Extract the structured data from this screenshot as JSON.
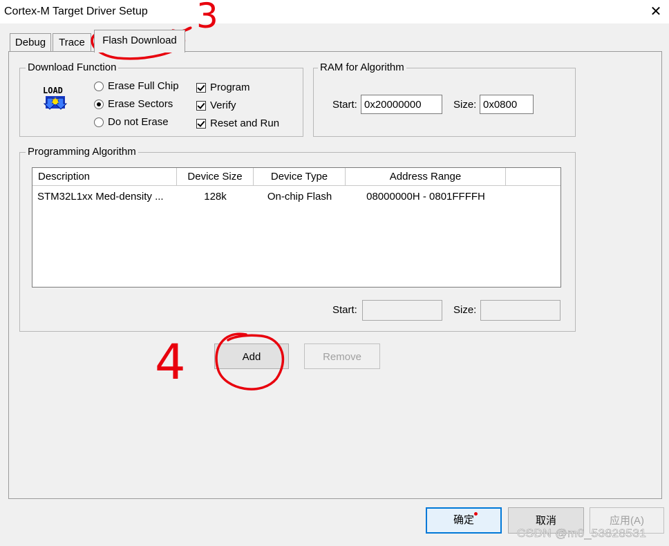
{
  "window": {
    "title": "Cortex-M Target Driver Setup"
  },
  "tabs": [
    {
      "label": "Debug"
    },
    {
      "label": "Trace"
    },
    {
      "label": "Flash Download"
    }
  ],
  "download_function": {
    "label": "Download Function",
    "icon": "load-icon",
    "icon_text": "LOAD",
    "erase_options": [
      {
        "label": "Erase Full Chip",
        "selected": false
      },
      {
        "label": "Erase Sectors",
        "selected": true
      },
      {
        "label": "Do not Erase",
        "selected": false
      }
    ],
    "checkboxes": [
      {
        "label": "Program",
        "checked": true
      },
      {
        "label": "Verify",
        "checked": true
      },
      {
        "label": "Reset and Run",
        "checked": true
      }
    ]
  },
  "ram": {
    "label": "RAM for Algorithm",
    "start_label": "Start:",
    "start_value": "0x20000000",
    "size_label": "Size:",
    "size_value": "0x0800"
  },
  "programming_algorithm": {
    "label": "Programming Algorithm",
    "columns": [
      "Description",
      "Device Size",
      "Device Type",
      "Address Range"
    ],
    "rows": [
      [
        "STM32L1xx Med-density ...",
        "128k",
        "On-chip Flash",
        "08000000H - 0801FFFFH"
      ]
    ],
    "start_label": "Start:",
    "start_value": "",
    "size_label": "Size:",
    "size_value": ""
  },
  "buttons": {
    "add": "Add",
    "remove": "Remove",
    "ok": "确定",
    "cancel": "取消",
    "apply": "应用(A)"
  },
  "annotations": {
    "step3": "3",
    "step4": "4"
  },
  "watermark": "CSDN @m0_53828531",
  "colors": {
    "annotation_red": "#e8000d",
    "accent_blue": "#0078d7"
  }
}
